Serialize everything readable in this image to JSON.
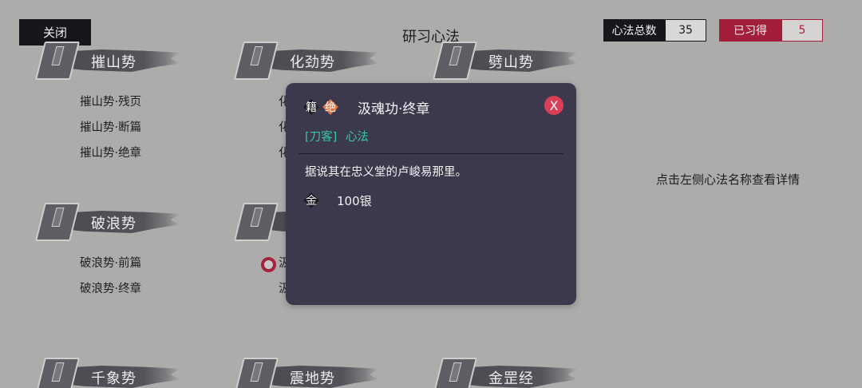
{
  "header": {
    "close_label": "关闭",
    "title": "研习心法",
    "total_label": "心法总数",
    "total_value": "35",
    "learned_label": "已习得",
    "learned_value": "5"
  },
  "groups": [
    {
      "title": "摧山势",
      "items": [
        "摧山势·残页",
        "摧山势·断篇",
        "摧山势·绝章"
      ]
    },
    {
      "title": "化劲势",
      "items": [
        "化",
        "化",
        "化"
      ]
    },
    {
      "title": "劈山势",
      "items": []
    },
    {
      "title": "破浪势",
      "items": [
        "破浪势·前篇",
        "破浪势·终章"
      ]
    },
    {
      "title": "",
      "items": [
        "汲",
        "汲"
      ]
    },
    {
      "title": "千象势",
      "items": []
    },
    {
      "title": "震地势",
      "items": []
    },
    {
      "title": "金罡经",
      "items": []
    }
  ],
  "hint": "点击左侧心法名称查看详情",
  "modal": {
    "badge_book": "籍",
    "badge_rank": "绝",
    "title": "汲魂功·终章",
    "sub_class": "[刀客]",
    "sub_type": "心法",
    "close_label": "X",
    "description": "据说其在忠义堂的卢峻易那里。",
    "price_badge": "金",
    "price": "100银"
  },
  "colors": {
    "background": "#aeacab",
    "modal": "#3c394d",
    "accent_red": "#a31e3a",
    "accent_green": "#35c9a4",
    "rank_orange": "#e07648"
  }
}
